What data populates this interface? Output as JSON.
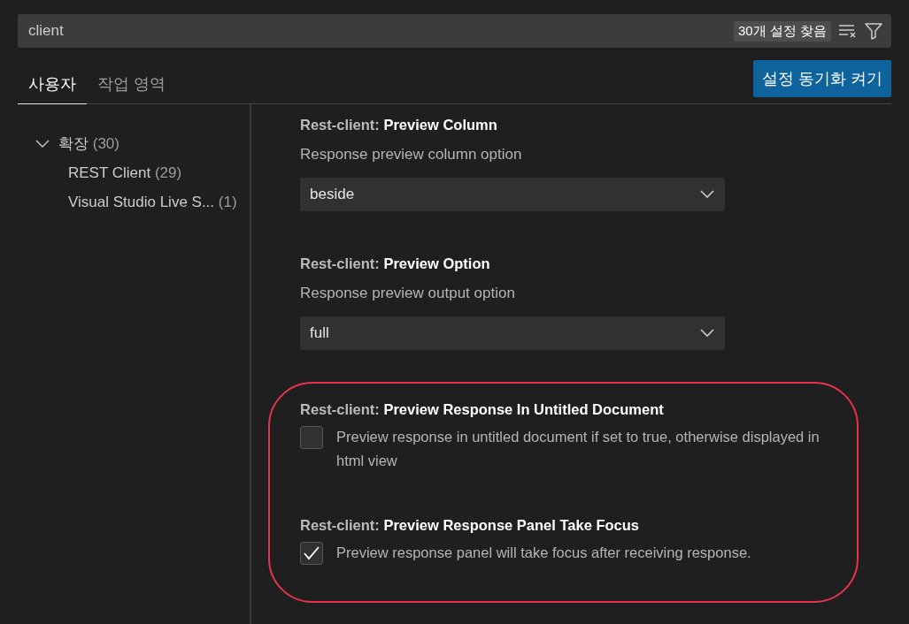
{
  "search": {
    "value": "client",
    "result_count": "30개 설정 찾음"
  },
  "tabs": [
    {
      "label": "사용자",
      "selected": true
    },
    {
      "label": "작업 영역",
      "selected": false
    }
  ],
  "sync_button": "설정 동기화 켜기",
  "tree": [
    {
      "label": "확장",
      "count": "(30)",
      "expanded": true,
      "children": [
        {
          "label": "REST Client",
          "count": "(29)"
        },
        {
          "label": "Visual Studio Live S...",
          "count": "(1)"
        }
      ]
    }
  ],
  "settings": [
    {
      "kind": "select",
      "title": "Rest-client: **Preview Column**",
      "description": "Response preview column option",
      "value": "beside",
      "highlighted": false
    },
    {
      "kind": "select",
      "title": "Rest-client: **Preview Option**",
      "description": "Response preview output option",
      "value": "full",
      "highlighted": false
    },
    {
      "kind": "checkbox",
      "title": "Rest-client: **Preview Response In Untitled Document**",
      "description": "Preview response in untitled document if set to true, otherwise displayed in html view",
      "checked": false,
      "highlighted": true
    },
    {
      "kind": "checkbox",
      "title": "Rest-client: **Preview Response Panel Take Focus**",
      "description": "Preview response panel will take focus after receiving response.",
      "checked": true,
      "highlighted": true
    }
  ]
}
